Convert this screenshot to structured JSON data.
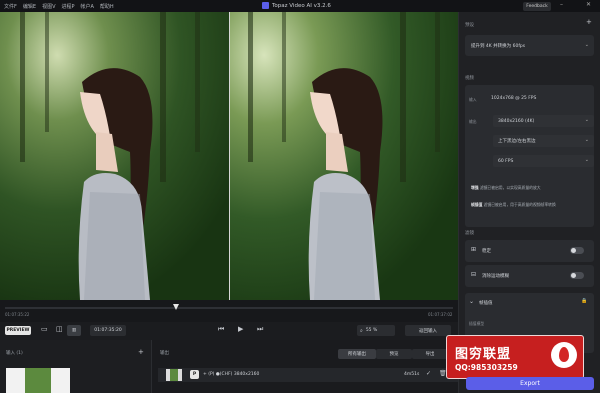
{
  "titlebar": {
    "menu": [
      "文件F",
      "编辑E",
      "视图V",
      "进程P",
      "帐户A",
      "帮助H"
    ],
    "app_title": "Topaz Video AI  v3.2.6",
    "feedback": "Feedback",
    "minimize": "–",
    "close": "✕"
  },
  "viewer": {
    "time_left": "01:07:35:22",
    "time_right": "01:07:37:02",
    "preview_label": "PREVIEW",
    "timecode": "01:07:35:20",
    "zoom": "55 %",
    "fit_label": "返回输入"
  },
  "input_panel": {
    "title": "输入 (1)",
    "add": "+"
  },
  "output_panel": {
    "title": "输出",
    "tabs": [
      "所有输出",
      "预览",
      "导出"
    ],
    "row": {
      "badge": "P",
      "resolution_info": "+ (P) ●(CHF) 3840x2160",
      "time": "4m51s"
    }
  },
  "right_panel": {
    "preset_label": "预设",
    "add": "+",
    "preset_value": "提升到 4K 并转换为 60fps",
    "output_label": "视频",
    "input_tag": "输入",
    "input_value": "1024x768 @ 25 FPS",
    "output_tag": "输出",
    "resolution": "3840x2160 (4K)",
    "crop": "上下黑边/左右黑边",
    "fps": "60 FPS",
    "note1_key": "增强",
    "note1": "滤镜已被启用，以实现高质量的放大",
    "note2_key": "帧插值",
    "note2": "滤镜已被启用，用于高质量的视频帧率转换",
    "filters_label": "滤镜",
    "stabilize": "稳定",
    "motion_deblur": "消除运动模糊",
    "frame_interp": "帧插值",
    "model_label": "插值模型",
    "export": "Export"
  },
  "watermark": {
    "brand": "图穷联盟",
    "qq": "QQ:985303259"
  },
  "colors": {
    "accent": "#5b5ee8",
    "watermark_red": "#c61f1f"
  }
}
